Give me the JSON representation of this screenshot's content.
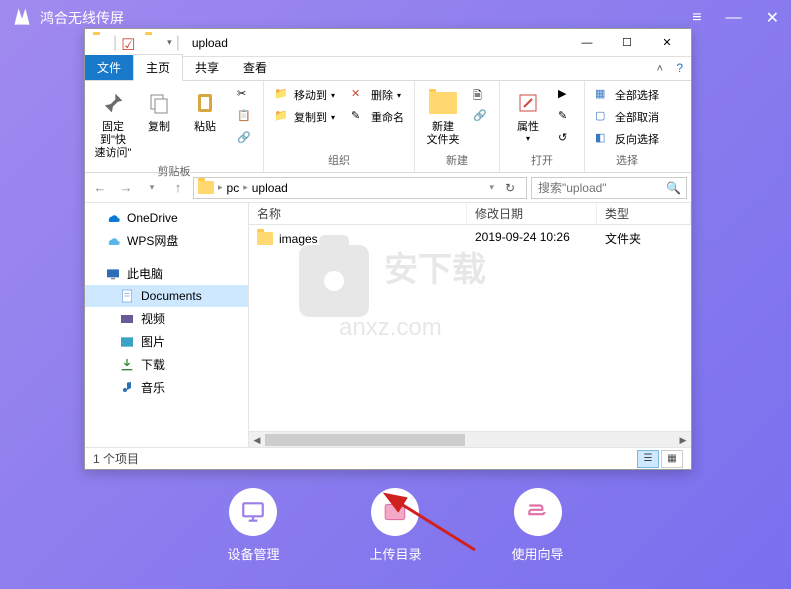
{
  "app": {
    "title": "鸿合无线传屏",
    "controls": {
      "menu": "≡",
      "minimize": "—",
      "close": "✕"
    }
  },
  "explorer": {
    "title": "upload",
    "qat": [
      "folder-icon",
      "checkbox-icon",
      "folder-new-icon"
    ],
    "win_controls": {
      "min": "—",
      "max": "☐",
      "close": "✕"
    },
    "tabs": {
      "file": "文件",
      "home": "主页",
      "share": "共享",
      "view": "查看"
    },
    "ribbon": {
      "clipboard": {
        "label": "剪贴板",
        "pin": "固定到\"快\n速访问\"",
        "copy": "复制",
        "paste": "粘贴"
      },
      "organize": {
        "label": "组织",
        "move_to": "移动到",
        "copy_to": "复制到",
        "delete": "删除",
        "rename": "重命名"
      },
      "new": {
        "label": "新建",
        "new_folder": "新建\n文件夹"
      },
      "open": {
        "label": "打开",
        "properties": "属性"
      },
      "select": {
        "label": "选择",
        "select_all": "全部选择",
        "deselect": "全部取消",
        "invert": "反向选择"
      }
    },
    "address": {
      "pc": "pc",
      "folder": "upload"
    },
    "search_placeholder": "搜索\"upload\"",
    "nav_pane": {
      "onedrive": "OneDrive",
      "wps": "WPS网盘",
      "this_pc": "此电脑",
      "documents": "Documents",
      "videos": "视频",
      "pictures": "图片",
      "downloads": "下载",
      "music": "音乐"
    },
    "columns": {
      "name": "名称",
      "date": "修改日期",
      "type": "类型"
    },
    "files": [
      {
        "name": "images",
        "date": "2019-09-24 10:26",
        "type": "文件夹"
      }
    ],
    "status": "1 个项目"
  },
  "watermark": {
    "line1": "安下载",
    "line2": "anxz.com"
  },
  "dock": {
    "device": "设备管理",
    "upload": "上传目录",
    "guide": "使用向导"
  }
}
